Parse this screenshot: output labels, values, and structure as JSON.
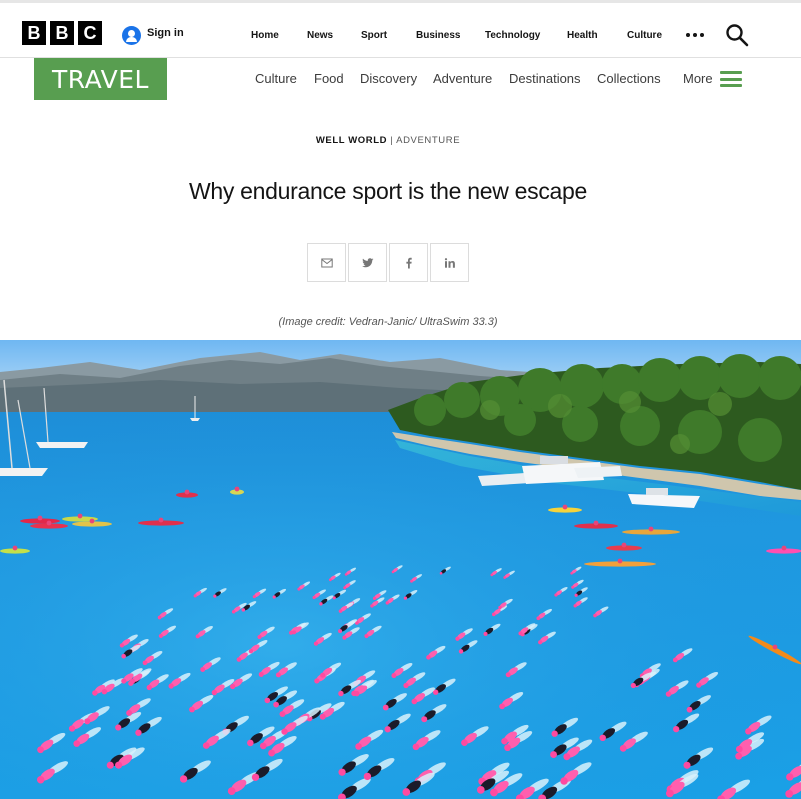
{
  "bbc": {
    "logo_letters": [
      "B",
      "B",
      "C"
    ],
    "signin_label": "Sign in"
  },
  "topnav": {
    "items": [
      {
        "label": "Home"
      },
      {
        "label": "News"
      },
      {
        "label": "Sport"
      },
      {
        "label": "Business"
      },
      {
        "label": "Technology"
      },
      {
        "label": "Health"
      },
      {
        "label": "Culture"
      }
    ]
  },
  "travel": {
    "logo": "TRAVEL",
    "nav": [
      {
        "label": "Culture"
      },
      {
        "label": "Food"
      },
      {
        "label": "Discovery"
      },
      {
        "label": "Adventure"
      },
      {
        "label": "Destinations"
      },
      {
        "label": "Collections"
      },
      {
        "label": "More"
      }
    ],
    "accent": "#589e50"
  },
  "article": {
    "kicker_primary": "WELL WORLD",
    "kicker_separator": "|",
    "kicker_secondary": "ADVENTURE",
    "headline": "Why endurance sport is the new escape",
    "share_icons": [
      "email-icon",
      "twitter-icon",
      "facebook-icon",
      "linkedin-icon"
    ],
    "image_credit": "(Image credit: Vedran-Janic/ UltraSwim 33.3)"
  }
}
